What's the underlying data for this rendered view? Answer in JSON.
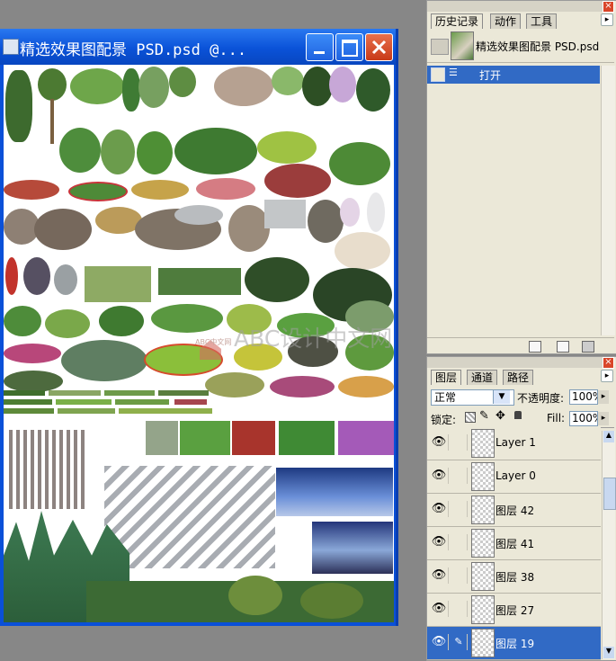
{
  "document": {
    "title": "精选效果图配景 PSD.psd @..."
  },
  "history_panel": {
    "tabs": [
      "历史记录",
      "动作",
      "工具"
    ],
    "snapshot_label": "精选效果图配景 PSD.psd",
    "states": [
      "打开"
    ]
  },
  "layers_panel": {
    "tabs": [
      "图层",
      "通道",
      "路径"
    ],
    "blend_mode": "正常",
    "opacity_label": "不透明度:",
    "opacity_value": "100%",
    "lock_label": "锁定:",
    "fill_label": "Fill:",
    "fill_value": "100%",
    "layers": [
      {
        "name": "Layer 1",
        "selected": false
      },
      {
        "name": "Layer 0",
        "selected": false
      },
      {
        "name": "图层 42",
        "selected": false
      },
      {
        "name": "图层 41",
        "selected": false
      },
      {
        "name": "图层 38",
        "selected": false
      },
      {
        "name": "图层 27",
        "selected": false
      },
      {
        "name": "图层 19",
        "selected": true
      }
    ]
  },
  "canvas": {
    "watermark": "ABC设计中文网",
    "logo_text": "ABC中文网"
  },
  "colors": {
    "titlebar_blue": "#0a52d8",
    "selection_blue": "#316ac5",
    "panel_bg": "#ebe8d8",
    "close_red": "#d9462a"
  }
}
